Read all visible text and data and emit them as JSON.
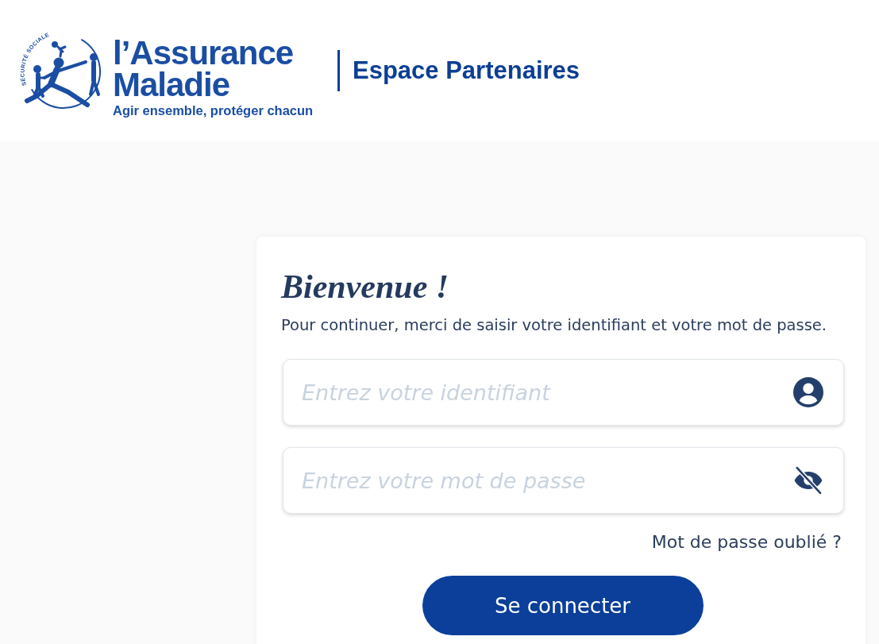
{
  "header": {
    "logo": {
      "arc_text": "SÉCURITÉ SOCIALE",
      "name_line_1": "l’Assurance",
      "name_line_2": "Maladie",
      "tagline": "Agir ensemble, protéger chacun"
    },
    "space_title": "Espace Partenaires"
  },
  "login": {
    "title": "Bienvenue !",
    "intro": "Pour continuer, merci de saisir votre identifiant et votre mot de passe.",
    "fields": [
      {
        "kind": "user",
        "placeholder": "Entrez votre identifiant"
      },
      {
        "kind": "password",
        "placeholder": "Entrez votre mot de passe"
      }
    ],
    "forgot_link": "Mot de passe oublié ?",
    "submit": "Se connecter"
  }
}
